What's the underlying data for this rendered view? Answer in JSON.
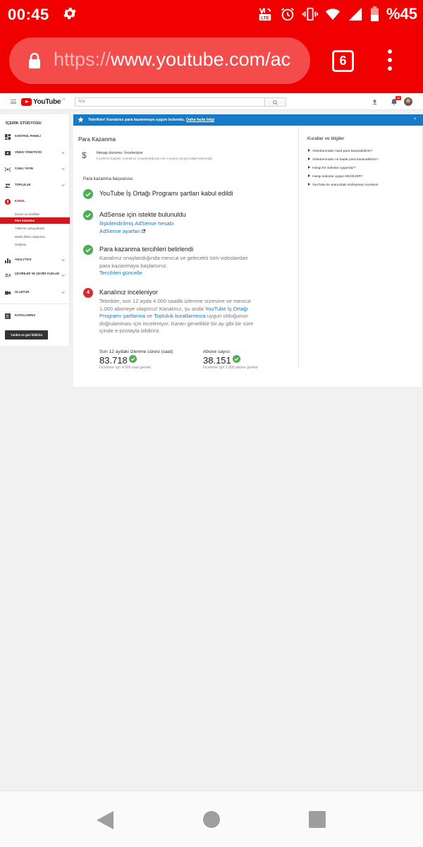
{
  "status_bar": {
    "time": "00:45",
    "battery_percent": "%45",
    "icons": [
      "gear-icon",
      "volte-icon",
      "alarm-icon",
      "vibrate-icon",
      "wifi-icon",
      "signal-icon",
      "battery-icon"
    ]
  },
  "browser": {
    "url_scheme": "https://",
    "url_rest": "www.youtube.com/ac",
    "tab_count": "6",
    "accent_color": "#f00000"
  },
  "yt_header": {
    "logo_text": "YouTube",
    "logo_suffix": "TR",
    "search_placeholder": "Ara",
    "notification_count": "12"
  },
  "sidebar": {
    "title": "İÇERİK STÜDYOSU",
    "nav": [
      {
        "label": "KONTROL PANELİ",
        "icon": "dashboard-icon"
      },
      {
        "label": "VİDEO YÖNETİCİSİ",
        "icon": "video-manager-icon"
      },
      {
        "label": "CANLI YAYIN",
        "icon": "live-icon"
      },
      {
        "label": "TOPLULUK",
        "icon": "community-icon"
      },
      {
        "label": "KANAL",
        "icon": "channel-icon"
      },
      {
        "label": "ANALYTICS",
        "icon": "analytics-icon"
      },
      {
        "label": "ÇEVİRİLER VE ÇEVİRİ YAZILAR",
        "icon": "translate-icon"
      },
      {
        "label": "OLUŞTUR",
        "icon": "create-icon"
      },
      {
        "label": "KATKILARINIZ",
        "icon": "contributions-icon"
      }
    ],
    "kanal_sub": [
      "Durum ve özellikler",
      "Para kazanma",
      "Yükleme varsayılanları",
      "Marka bilinci oluşturma",
      "Gelişmiş"
    ],
    "feedback_label": "Yardım ve geri bildirim"
  },
  "banner": {
    "message": "Tebrikler! Kanalınız para kazanmaya uygun bulundu.",
    "link": "Daha fazla bilgi",
    "close": "×",
    "color": "#167ac6"
  },
  "main": {
    "heading": "Para Kazanma",
    "account_status": "Hesap durumu: İnceleniyor",
    "account_status_desc": "İnceleme başladı. Kanalınız onaylandığında size e-posta yoluyla bilgilendireceğiz.",
    "application_heading": "Para kazanma başvurusu",
    "step1_title": "YouTube İş Ortağı Programı şartları kabul edildi",
    "step2_title": "AdSense için istekte bulunuldu",
    "step2_link1": "İlişkilendirilmiş AdSense hesabı",
    "step2_link2": "AdSense ayarları",
    "step3_title": "Para kazanma tercihleri belirlendi",
    "step3_desc": "Kanalınız onaylandığında mevcut ve gelecekti tüm videolardan para kazanmaya başlarsınız.",
    "step3_link": "Tercihleri güncelle",
    "step4_number": "4",
    "step4_title": "Kanalınız inceleniyor",
    "step4_desc_a": "Tebrikler, son 12 ayda 4.000 saatlik izlenme süresine ve mevcut 1.000 aboneye ulaştınız! Kanalınız, şu anda",
    "step4_link_a": "YouTube İş Ortağı Programı şartlarına",
    "step4_desc_b": "ve",
    "step4_link_b": "Topluluk kurallarımıza",
    "step4_desc_c": "uygun olduğunun doğrulanması için inceleniyor. Kararı genellikle bir ay gibi bir süre içinde e-postayla bildiririz.",
    "stat1_label": "Son 12 aydaki izlenme süresi (saat)",
    "stat1_value": "83.718",
    "stat1_req": "İnceleme için 4.000 saat gerekir",
    "stat2_label": "Abone sayısı",
    "stat2_value": "38.151",
    "stat2_req": "İnceleme için 1.000 abone gerekir",
    "success_color": "#4caf50"
  },
  "rules": {
    "title": "Kurallar ve bilgiler",
    "items": [
      "Videolarımdan nasıl para kazanabilirim?",
      "Videolarımdan ne kadar para kazanabilirim?",
      "Hangi tür videolar uygundur?",
      "Hangi videolar uygun DEĞİLDİR?",
      "YouTube ile aranızdaki sözleşmeyi inceleyin"
    ]
  }
}
